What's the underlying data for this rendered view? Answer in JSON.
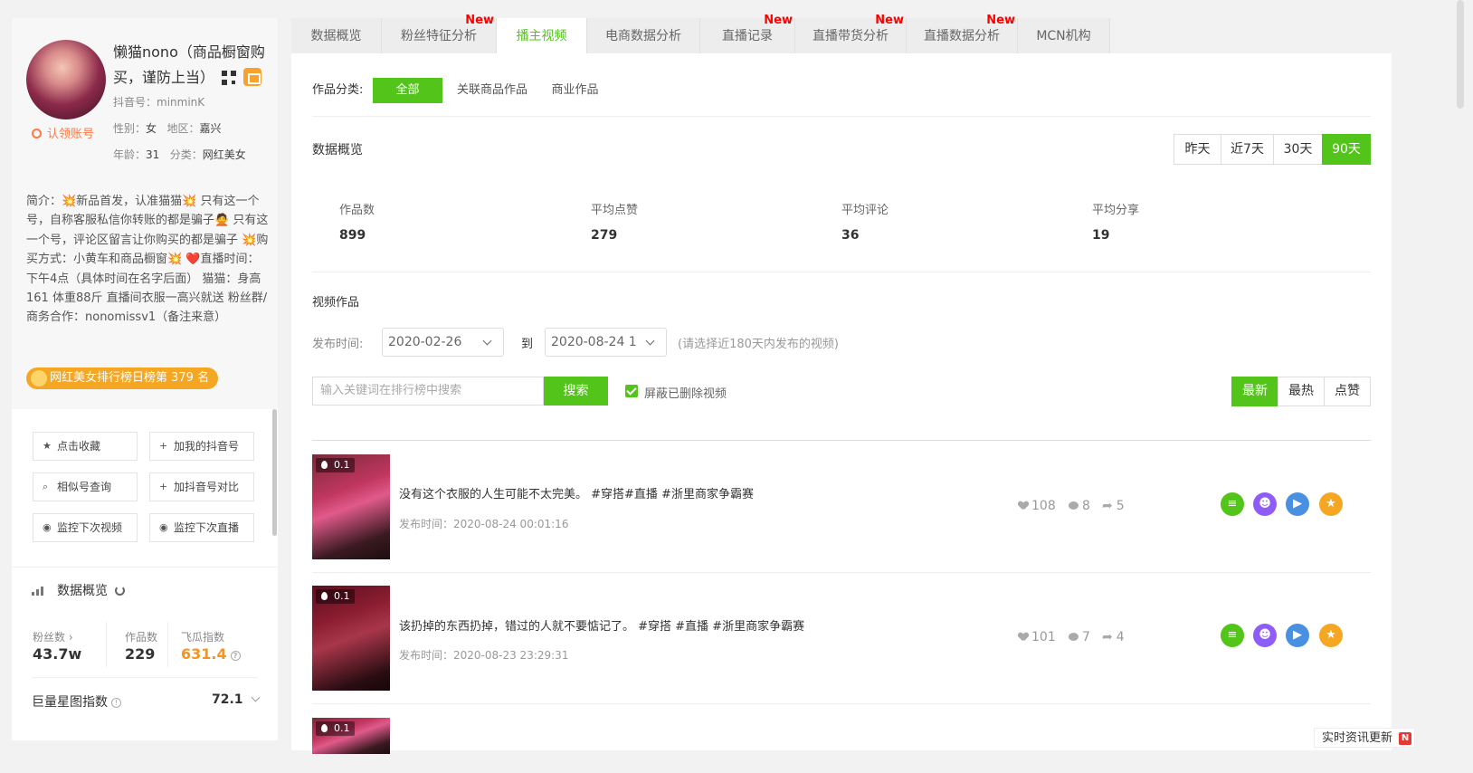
{
  "profile": {
    "name": "懒猫nono（商品橱窗购买，谨防上当）",
    "claim": "认领账号",
    "douyin_id_label": "抖音号：",
    "douyin_id": "minminK",
    "gender_label": "性别：",
    "gender": "女",
    "region_label": "地区：",
    "region": "嘉兴",
    "age_label": "年龄：",
    "age": "31",
    "category_label": "分类：",
    "category": "网红美女",
    "intro": "简介：💥新品首发，认准猫猫💥 只有这一个号，自称客服私信你转账的都是骗子🙅 只有这一个号，评论区留言让你购买的都是骗子 💥购买方式：小黄车和商品橱窗💥 ❤️直播时间：下午4点（具体时间在名字后面） 猫猫：身高161 体重88斤 直播间衣服一高兴就送 粉丝群/商务合作：nonomissv1（备注来意）",
    "rank": "网红美女排行榜日榜第 379 名"
  },
  "actions": {
    "collect": "点击收藏",
    "add_my": "加我的抖音号",
    "similar": "相似号查询",
    "compare": "加抖音号对比",
    "monitor_video": "监控下次视频",
    "monitor_live": "监控下次直播"
  },
  "overview": {
    "title": "数据概览",
    "fans_label": "粉丝数",
    "fans": "43.7w",
    "works_label": "作品数",
    "works": "229",
    "feigua_label": "飞瓜指数",
    "feigua": "631.4",
    "juliang_label": "巨量星图指数",
    "juliang": "72.1"
  },
  "tabs": [
    {
      "label": "数据概览",
      "new": ""
    },
    {
      "label": "粉丝特征分析",
      "new": "New"
    },
    {
      "label": "播主视频",
      "new": ""
    },
    {
      "label": "电商数据分析",
      "new": ""
    },
    {
      "label": "直播记录",
      "new": "New"
    },
    {
      "label": "直播带货分析",
      "new": "New"
    },
    {
      "label": "直播数据分析",
      "new": "New"
    },
    {
      "label": "MCN机构",
      "new": ""
    }
  ],
  "main": {
    "category_label": "作品分类:",
    "cat_all": "全部",
    "cat_linked": "关联商品作品",
    "cat_commercial": "商业作品",
    "overview_title": "数据概览",
    "ranges": [
      "昨天",
      "近7天",
      "30天",
      "90天"
    ],
    "summary": [
      {
        "label": "作品数",
        "value": "899"
      },
      {
        "label": "平均点赞",
        "value": "279"
      },
      {
        "label": "平均评论",
        "value": "36"
      },
      {
        "label": "平均分享",
        "value": "19"
      }
    ],
    "videos_title": "视频作品",
    "publish_label": "发布时间:",
    "date_from": "2020-02-26",
    "to_label": "到",
    "date_to": "2020-08-24 1",
    "date_hint": "(请选择近180天内发布的视频)",
    "search_placeholder": "输入关键词在排行榜中搜索",
    "search_btn": "搜索",
    "hide_deleted": "屏蔽已删除视频",
    "sorts": [
      "最新",
      "最热",
      "点赞"
    ]
  },
  "videos": [
    {
      "heat": "0.1",
      "title": "没有这个衣服的人生可能不太完美。 #穿搭#直播 #浙里商家争霸赛",
      "time": "发布时间：2020-08-24 00:01:16",
      "likes": "108",
      "comments": "8",
      "shares": "5"
    },
    {
      "heat": "0.1",
      "title": "该扔掉的东西扔掉，错过的人就不要惦记了。 #穿搭 #直播 #浙里商家争霸赛",
      "time": "发布时间：2020-08-23 23:29:31",
      "likes": "101",
      "comments": "7",
      "shares": "4"
    },
    {
      "heat": "0.1"
    }
  ],
  "float_news": "实时资讯更新",
  "float_news_badge": "N",
  "colors": {
    "accent": "#52c41a",
    "new": "#ff0000",
    "orange": "#f5a623"
  }
}
